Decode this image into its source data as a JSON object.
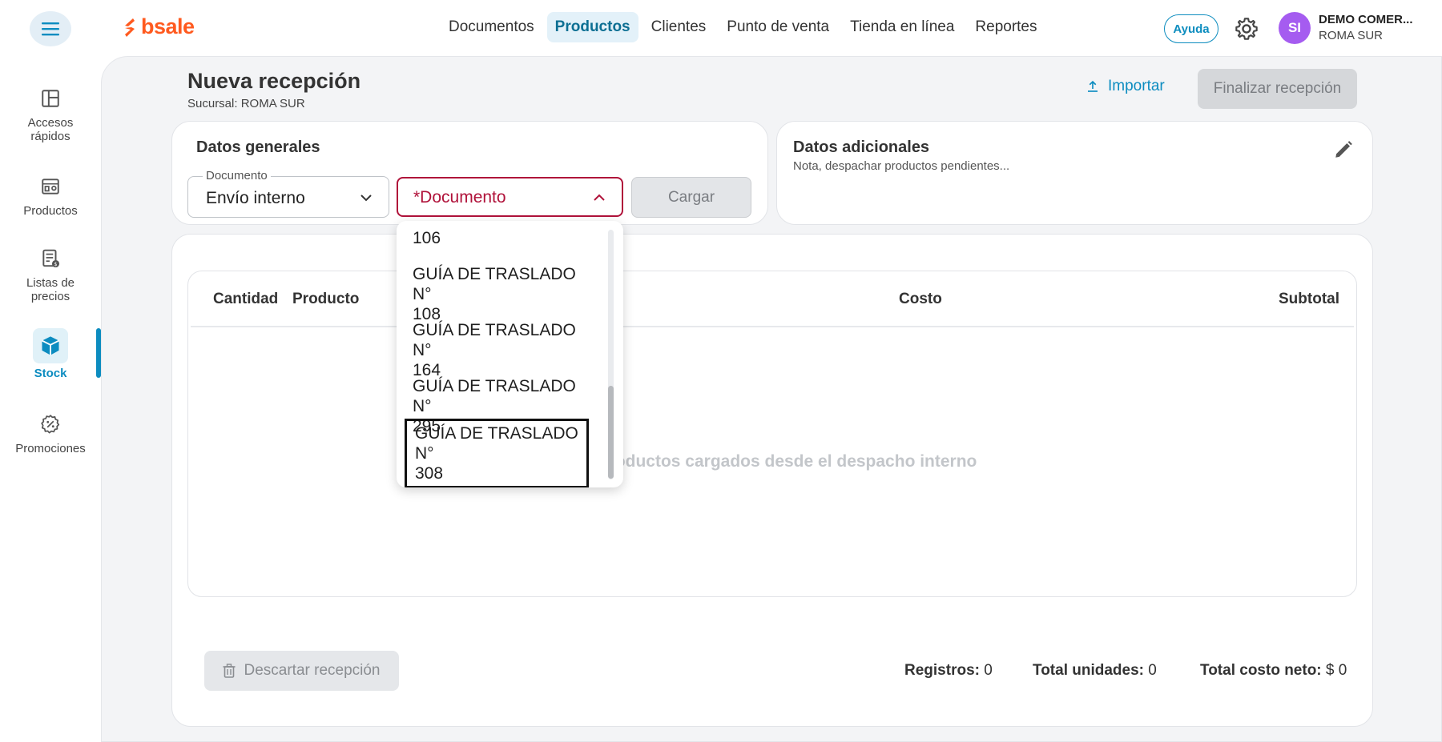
{
  "header": {
    "logo_text": "bsale",
    "nav": [
      "Documentos",
      "Productos",
      "Clientes",
      "Punto de venta",
      "Tienda en línea",
      "Reportes"
    ],
    "active_nav": "Productos",
    "help_label": "Ayuda",
    "avatar_initials": "SI",
    "company_name": "DEMO COMER...",
    "company_branch": "ROMA SUR"
  },
  "sidebar": {
    "items": [
      {
        "label_line1": "Accesos",
        "label_line2": "rápidos"
      },
      {
        "label_line1": "Productos",
        "label_line2": ""
      },
      {
        "label_line1": "Listas de",
        "label_line2": "precios"
      },
      {
        "label_line1": "Stock",
        "label_line2": ""
      },
      {
        "label_line1": "Promociones",
        "label_line2": ""
      }
    ],
    "active": "Stock"
  },
  "page": {
    "title": "Nueva recepción",
    "subtitle": "Sucursal: ROMA SUR",
    "import_label": "Importar",
    "finish_label": "Finalizar recepción"
  },
  "general": {
    "title": "Datos generales",
    "document_legend": "Documento",
    "document_value": "Envío interno",
    "select_placeholder": "*Documento",
    "load_label": "Cargar"
  },
  "additional": {
    "title": "Datos adicionales",
    "note": "Nota, despachar productos pendientes..."
  },
  "table": {
    "headers": [
      "Cantidad",
      "Producto",
      "Costo",
      "Subtotal"
    ],
    "empty_message_visible": "los productos cargados desde el despacho interno"
  },
  "dropdown": {
    "options": [
      {
        "line1": "106",
        "line2": ""
      },
      {
        "line1": "GUÍA DE TRASLADO N°",
        "line2": "108"
      },
      {
        "line1": "GUÍA DE TRASLADO N°",
        "line2": "164"
      },
      {
        "line1": "GUÍA DE TRASLADO N°",
        "line2": "295"
      },
      {
        "line1": "GUÍA DE TRASLADO N°",
        "line2": "308"
      }
    ],
    "highlighted_index": 4
  },
  "footer": {
    "discard_label": "Descartar recepción",
    "registros_label": "Registros:",
    "registros_value": "0",
    "unidades_label": "Total unidades:",
    "unidades_value": "0",
    "costo_label": "Total costo neto:",
    "costo_value": "$ 0"
  },
  "colors": {
    "accent": "#0c8cc0",
    "brand": "#ff5a1f",
    "error": "#b0123a",
    "avatar": "#a55cf0"
  }
}
